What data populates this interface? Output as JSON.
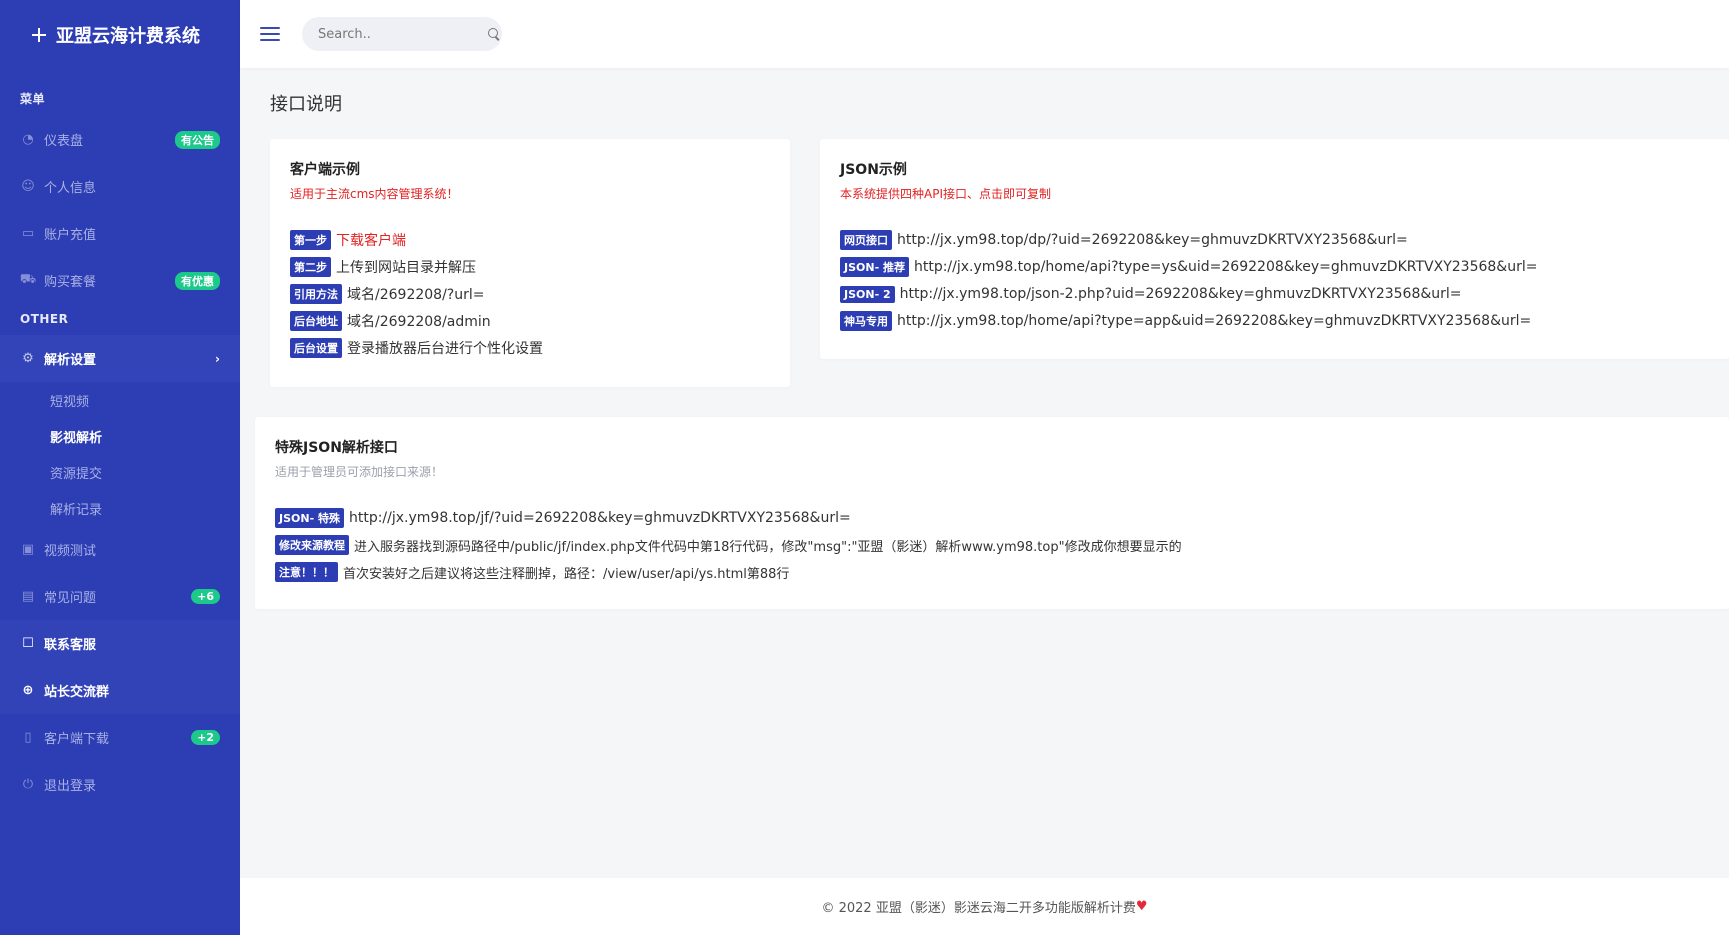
{
  "brand": {
    "title": "亚盟云海计费系统"
  },
  "sidebar": {
    "section_menu": "菜单",
    "section_other": "OTHER",
    "items": [
      {
        "label": "仪表盘",
        "badge": "有公告",
        "icon": "dashboard-icon"
      },
      {
        "label": "个人信息",
        "icon": "user-icon"
      },
      {
        "label": "账户充值",
        "icon": "card-icon"
      },
      {
        "label": "购买套餐",
        "badge": "有优惠",
        "icon": "cart-icon"
      },
      {
        "label": "解析设置",
        "icon": "gear-icon"
      },
      {
        "label": "视频测试",
        "icon": "video-icon"
      },
      {
        "label": "常见问题",
        "badge": "+6",
        "icon": "document-icon"
      },
      {
        "label": "联系客服",
        "icon": "chat-icon"
      },
      {
        "label": "站长交流群",
        "icon": "plus-circle-icon"
      },
      {
        "label": "客户端下载",
        "badge": "+2",
        "icon": "file-icon"
      },
      {
        "label": "退出登录",
        "icon": "power-icon"
      }
    ],
    "subitems": [
      "短视频",
      "影视解析",
      "资源提交",
      "解析记录"
    ]
  },
  "search": {
    "placeholder": "Search.."
  },
  "page": {
    "title": "接口说明"
  },
  "client_card": {
    "title": "客户端示例",
    "subtitle": "适用于主流cms内容管理系统！",
    "rows": [
      {
        "tag": "第一步",
        "value": "下载客户端"
      },
      {
        "tag": "第二步",
        "value": "上传到网站目录并解压"
      },
      {
        "tag": "引用方法",
        "value": "域名/2692208/?url="
      },
      {
        "tag": "后台地址",
        "value": "域名/2692208/admin"
      },
      {
        "tag": "后台设置",
        "value": "登录播放器后台进行个性化设置"
      }
    ]
  },
  "json_card": {
    "title": "JSON示例",
    "subtitle": "本系统提供四种API接口、点击即可复制",
    "rows": [
      {
        "tag": "网页接口",
        "value": "http://jx.ym98.top/dp/?uid=2692208&key=ghmuvzDKRTVXY23568&url="
      },
      {
        "tag": "JSON- 推荐",
        "value": "http://jx.ym98.top/home/api?type=ys&uid=2692208&key=ghmuvzDKRTVXY23568&url="
      },
      {
        "tag": "JSON- 2",
        "value": "http://jx.ym98.top/json-2.php?uid=2692208&key=ghmuvzDKRTVXY23568&url="
      },
      {
        "tag": "神马专用",
        "value": "http://jx.ym98.top/home/api?type=app&uid=2692208&key=ghmuvzDKRTVXY23568&url="
      }
    ]
  },
  "special_card": {
    "title": "特殊JSON解析接口",
    "subtitle": "适用于管理员可添加接口来源！",
    "rows": [
      {
        "tag": "JSON- 特殊",
        "value": "http://jx.ym98.top/jf/?uid=2692208&key=ghmuvzDKRTVXY23568&url="
      },
      {
        "tag": "修改来源教程",
        "value": "进入服务器找到源码路径中/public/jf/index.php文件代码中第18行代码，修改\"msg\":\"亚盟（影迷）解析www.ym98.top\"修改成你想要显示的"
      },
      {
        "tag": "注意！！！",
        "value": "首次安装好之后建议将这些注释删掉，路径：/view/user/api/ys.html第88行"
      }
    ]
  },
  "footer": {
    "text": "© 2022 亚盟（影迷）影迷云海二开多功能版解析计费"
  }
}
